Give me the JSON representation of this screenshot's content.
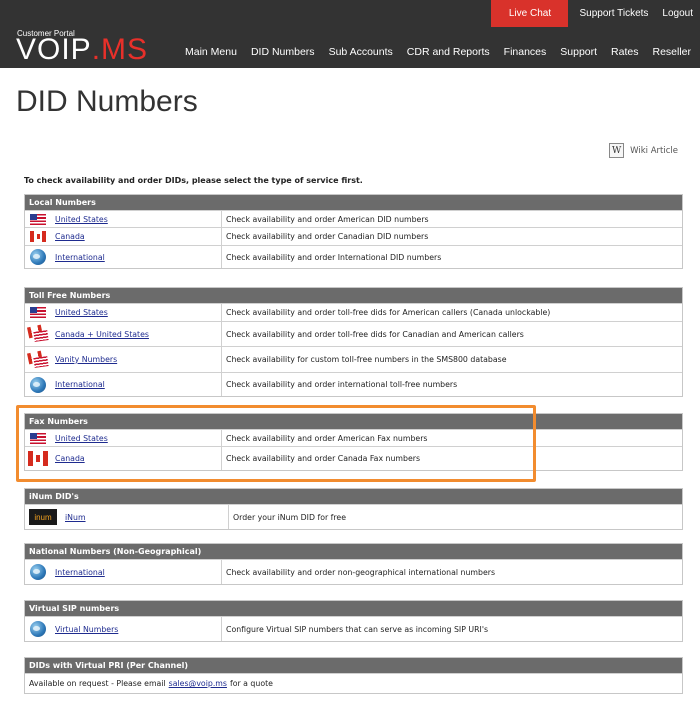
{
  "header": {
    "portal_label": "Customer Portal",
    "logo_part_a": "VOIP",
    "logo_part_b": ".MS",
    "top_links": {
      "live_chat": "Live Chat",
      "support_tickets": "Support Tickets",
      "logout": "Logout"
    },
    "nav": [
      "Main Menu",
      "DID Numbers",
      "Sub Accounts",
      "CDR and Reports",
      "Finances",
      "Support",
      "Rates",
      "Reseller"
    ]
  },
  "page": {
    "title": "DID Numbers",
    "wiki_label": "Wiki Article",
    "wiki_icon_letter": "W",
    "intro": "To check availability and order DIDs, please select the type of service first."
  },
  "sections": {
    "local": {
      "title": "Local Numbers",
      "rows": [
        {
          "icon": "us-flag-icon",
          "name": "United States",
          "desc": "Check availability and order American DID numbers"
        },
        {
          "icon": "canada-flag-icon",
          "name": "Canada",
          "desc": "Check availability and order Canadian DID numbers"
        },
        {
          "icon": "globe-icon",
          "name": "International",
          "desc": "Check availability and order International DID numbers"
        }
      ]
    },
    "tollfree": {
      "title": "Toll Free Numbers",
      "rows": [
        {
          "icon": "us-flag-icon",
          "name": "United States",
          "desc": "Check availability and order toll-free dids for American callers (Canada unlockable)"
        },
        {
          "icon": "canada-us-flags-icon",
          "name": "Canada + United States",
          "desc": "Check availability and order toll-free dids for Canadian and American callers"
        },
        {
          "icon": "canada-us-flags-icon",
          "name": "Vanity Numbers",
          "desc": "Check availability for custom toll-free numbers in the SMS800 database"
        },
        {
          "icon": "globe-icon",
          "name": "International",
          "desc": "Check availability and order international toll-free numbers"
        }
      ]
    },
    "fax": {
      "title": "Fax Numbers",
      "rows": [
        {
          "icon": "us-flag-icon",
          "name": "United States",
          "desc": "Check availability and order American Fax numbers"
        },
        {
          "icon": "canada-flag-icon",
          "name": "Canada",
          "desc": "Check availability and order Canada Fax numbers"
        }
      ]
    },
    "inum": {
      "title": "iNum DID's",
      "icon_text": "inum",
      "rows": [
        {
          "icon": "inum-logo-icon",
          "name": "iNum",
          "desc": "Order your iNum DID for free"
        }
      ]
    },
    "national": {
      "title": "National Numbers (Non-Geographical)",
      "rows": [
        {
          "icon": "globe-icon",
          "name": "International",
          "desc": "Check availability and order non-geographical international numbers"
        }
      ]
    },
    "sip": {
      "title": "Virtual SIP numbers",
      "rows": [
        {
          "icon": "globe-icon",
          "name": "Virtual Numbers",
          "desc": "Configure Virtual SIP numbers that can serve as incoming SIP URI's"
        }
      ]
    },
    "pri": {
      "title": "DIDs with Virtual PRI (Per Channel)",
      "text_before": "Available on request - Please email",
      "email": "sales@voip.ms",
      "text_after": "for a quote"
    }
  },
  "colors": {
    "header_bg": "#333333",
    "live_chat_bg": "#d9322b",
    "section_header_bg": "#6b6b6b",
    "link": "#1e2b8f",
    "highlight": "#f28c2f"
  }
}
